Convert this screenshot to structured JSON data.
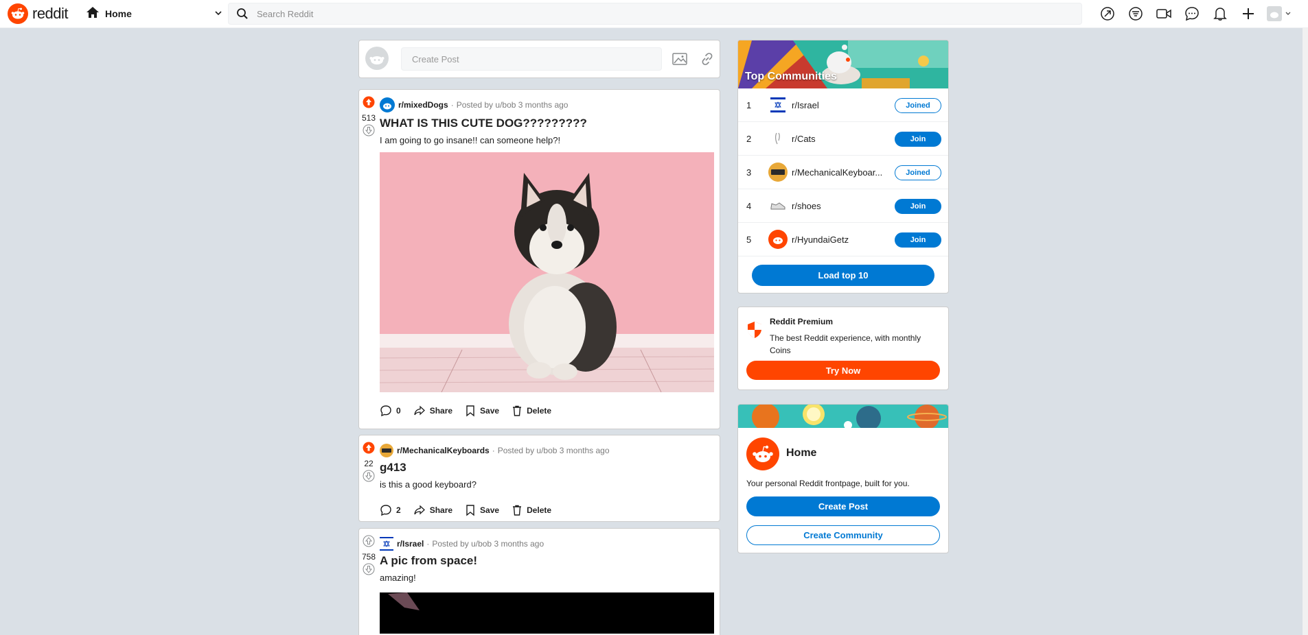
{
  "header": {
    "logo_text": "reddit",
    "feed_label": "Home",
    "search_placeholder": "Search Reddit",
    "icons": [
      "popular-icon",
      "filter-icon",
      "video-icon",
      "chat-icon",
      "notification-icon",
      "plus-icon",
      "user-avatar"
    ]
  },
  "create_post": {
    "placeholder": "Create Post"
  },
  "posts": [
    {
      "votes": "513",
      "subreddit": "r/mixedDogs",
      "meta": "Posted by u/bob 3 months ago",
      "title": "WHAT IS THIS CUTE DOG?????????",
      "body": "I am going to go insane!! can someone help?!",
      "comments": "0",
      "share": "Share",
      "save": "Save",
      "delete": "Delete",
      "upvoted": true
    },
    {
      "votes": "22",
      "subreddit": "r/MechanicalKeyboards",
      "meta": "Posted by u/bob 3 months ago",
      "title": "g413",
      "body": "is this a good keyboard?",
      "comments": "2",
      "share": "Share",
      "save": "Save",
      "delete": "Delete",
      "upvoted": true
    },
    {
      "votes": "758",
      "subreddit": "r/Israel",
      "meta": "Posted by u/bob 3 months ago",
      "title": "A pic from space!",
      "body": "amazing!",
      "upvoted": false
    }
  ],
  "top_communities": {
    "title": "Top Communities",
    "items": [
      {
        "rank": "1",
        "name": "r/Israel",
        "button": "Joined"
      },
      {
        "rank": "2",
        "name": "r/Cats",
        "button": "Join"
      },
      {
        "rank": "3",
        "name": "r/MechanicalKeyboar...",
        "button": "Joined"
      },
      {
        "rank": "4",
        "name": "r/shoes",
        "button": "Join"
      },
      {
        "rank": "5",
        "name": "r/HyundaiGetz",
        "button": "Join"
      }
    ],
    "load_button": "Load top 10"
  },
  "premium": {
    "title": "Reddit Premium",
    "desc": "The best Reddit experience, with monthly Coins",
    "button": "Try Now"
  },
  "home_card": {
    "title": "Home",
    "desc": "Your personal Reddit frontpage, built for you.",
    "create_post": "Create Post",
    "create_community": "Create Community"
  },
  "colors": {
    "orange": "#ff4500",
    "blue": "#0079d3",
    "bg": "#dae0e6"
  }
}
